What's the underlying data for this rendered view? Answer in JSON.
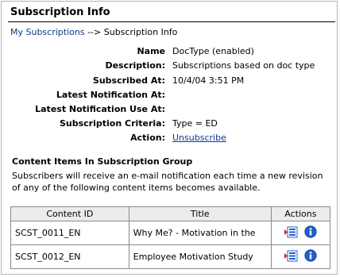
{
  "header": {
    "title": "Subscription Info",
    "breadcrumb": {
      "link_label": "My Subscriptions",
      "separator": "-->",
      "current": "Subscription Info"
    }
  },
  "info": {
    "name_label": "Name",
    "name_value": "DocType (enabled)",
    "description_label": "Description:",
    "description_value": "Subscriptions based on doc type",
    "subscribed_at_label": "Subscribed At:",
    "subscribed_at_value": "10/4/04 3:51 PM",
    "latest_notification_label": "Latest Notification At:",
    "latest_notification_value": "",
    "latest_notification_use_label": "Latest Notification Use At:",
    "latest_notification_use_value": "",
    "criteria_label": "Subscription Criteria:",
    "criteria_value": "Type = ED",
    "action_label": "Action:",
    "action_link": "Unsubscribe"
  },
  "content_items": {
    "heading": "Content Items In Subscription Group",
    "description": "Subscribers will receive an e-mail notification each time a new revision of any of the following content items becomes available.",
    "columns": [
      "Content ID",
      "Title",
      "Actions"
    ],
    "rows": [
      {
        "content_id": "SCST_0011_EN",
        "title": "Why Me? - Motivation in the",
        "actions": [
          "actions-menu-icon",
          "info-icon"
        ]
      },
      {
        "content_id": "SCST_0012_EN",
        "title": "Employee Motivation Study",
        "actions": [
          "actions-menu-icon",
          "info-icon"
        ]
      }
    ]
  },
  "colors": {
    "link": "#0a3a8c",
    "header_bg": "#ececec",
    "border": "#8a8a8a",
    "icon_blue": "#1f5fd0"
  }
}
